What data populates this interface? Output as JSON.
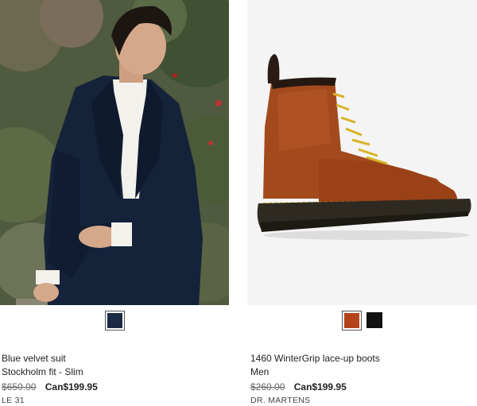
{
  "products": [
    {
      "title": "Blue velvet suit",
      "subtitle": "Stockholm fit - Slim",
      "old_price": "$650.00",
      "new_price": "Can$199.95",
      "brand": "LE 31",
      "image_icon": "velvet-suit-photo",
      "swatches": [
        {
          "color": "#1b2a44",
          "selected": true
        }
      ]
    },
    {
      "title": "1460 WinterGrip lace-up boots",
      "subtitle": "Men",
      "old_price": "$260.00",
      "new_price": "Can$199.95",
      "brand": "DR. MARTENS",
      "image_icon": "leather-boot-photo",
      "swatches": [
        {
          "color": "#b4421a",
          "selected": true
        },
        {
          "color": "#111111",
          "selected": false
        }
      ]
    }
  ]
}
